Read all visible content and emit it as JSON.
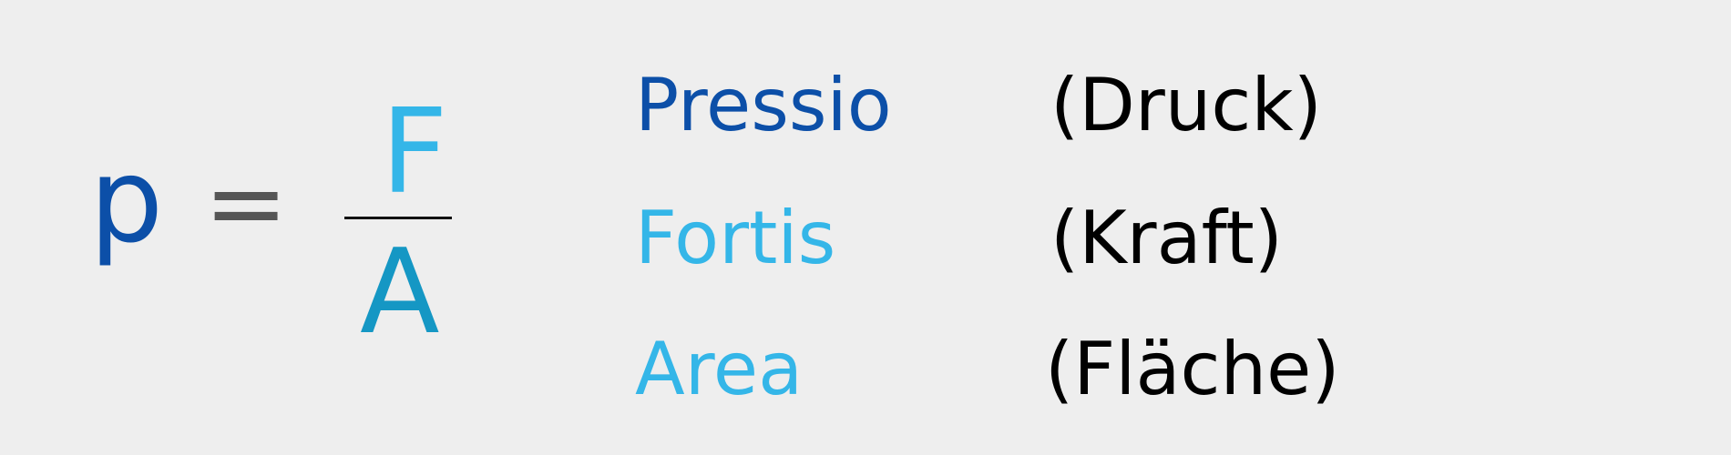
{
  "formula": {
    "lhs": "p",
    "equals": "=",
    "numerator": "F",
    "denominator": "A"
  },
  "glossary": [
    {
      "term": "Pressio",
      "translation": "(Druck)",
      "color": "#0c4fa8"
    },
    {
      "term": "Fortis",
      "translation": "(Kraft)",
      "color": "#34b6e8"
    },
    {
      "term": "Area",
      "translation": "(Fläche)",
      "color": "#34b6e8"
    }
  ],
  "colors": {
    "p": "#0c4fa8",
    "equals": "#555555",
    "numerator": "#34b6e8",
    "denominator": "#1597c4",
    "fraction_bar": "#111111",
    "translation": "#000000",
    "background": "#eeeeee"
  }
}
